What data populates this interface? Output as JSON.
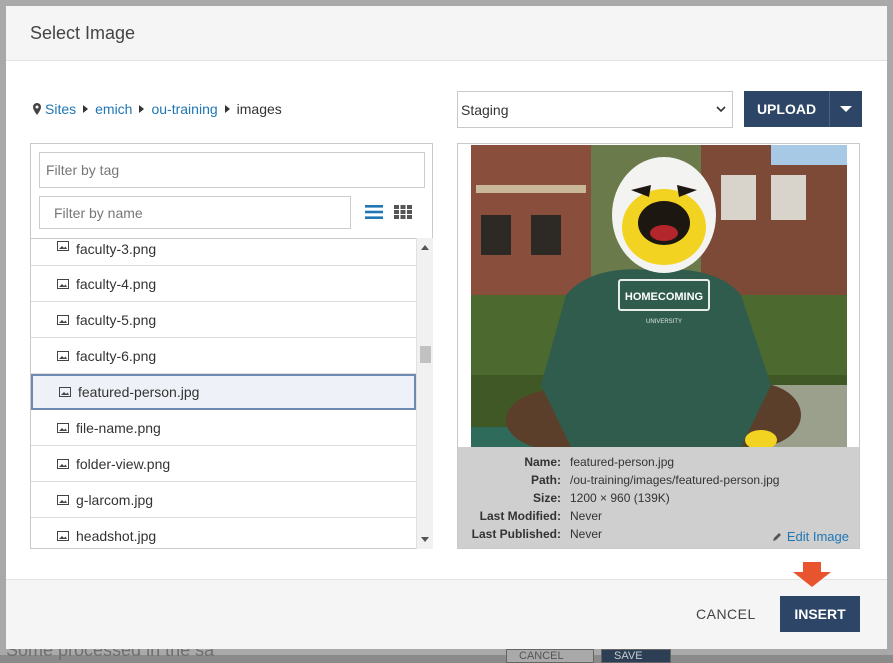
{
  "dialog": {
    "title": "Select Image"
  },
  "breadcrumb": {
    "items": [
      "Sites",
      "emich",
      "ou-training"
    ],
    "current": "images"
  },
  "filters": {
    "tag_placeholder": "Filter by tag",
    "name_placeholder": "Filter by name"
  },
  "files": [
    "faculty-3.png",
    "faculty-4.png",
    "faculty-5.png",
    "faculty-6.png",
    "featured-person.jpg",
    "file-name.png",
    "folder-view.png",
    "g-larcom.jpg",
    "headshot.jpg"
  ],
  "selected_file": "featured-person.jpg",
  "environment": {
    "selected": "Staging"
  },
  "upload": {
    "label": "UPLOAD"
  },
  "preview": {
    "shirt_text": "HOMECOMING",
    "shirt_subtext": "UNIVERSITY",
    "meta": [
      {
        "key": "Name:",
        "value": "featured-person.jpg"
      },
      {
        "key": "Path:",
        "value": "/ou-training/images/featured-person.jpg"
      },
      {
        "key": "Size:",
        "value": "1200 × 960 (139K)"
      },
      {
        "key": "Last Modified:",
        "value": "Never"
      },
      {
        "key": "Last Published:",
        "value": "Never"
      }
    ],
    "edit_label": "Edit Image"
  },
  "footer": {
    "cancel_label": "CANCEL",
    "insert_label": "INSERT"
  },
  "background": {
    "text": "Some processed in the sa",
    "cancel": "CANCEL",
    "save": "SAVE"
  },
  "colors": {
    "primary": "#2d4667",
    "link": "#1f76b5",
    "hint_arrow": "#e8542d",
    "meta_bg": "#cfcfcf"
  }
}
